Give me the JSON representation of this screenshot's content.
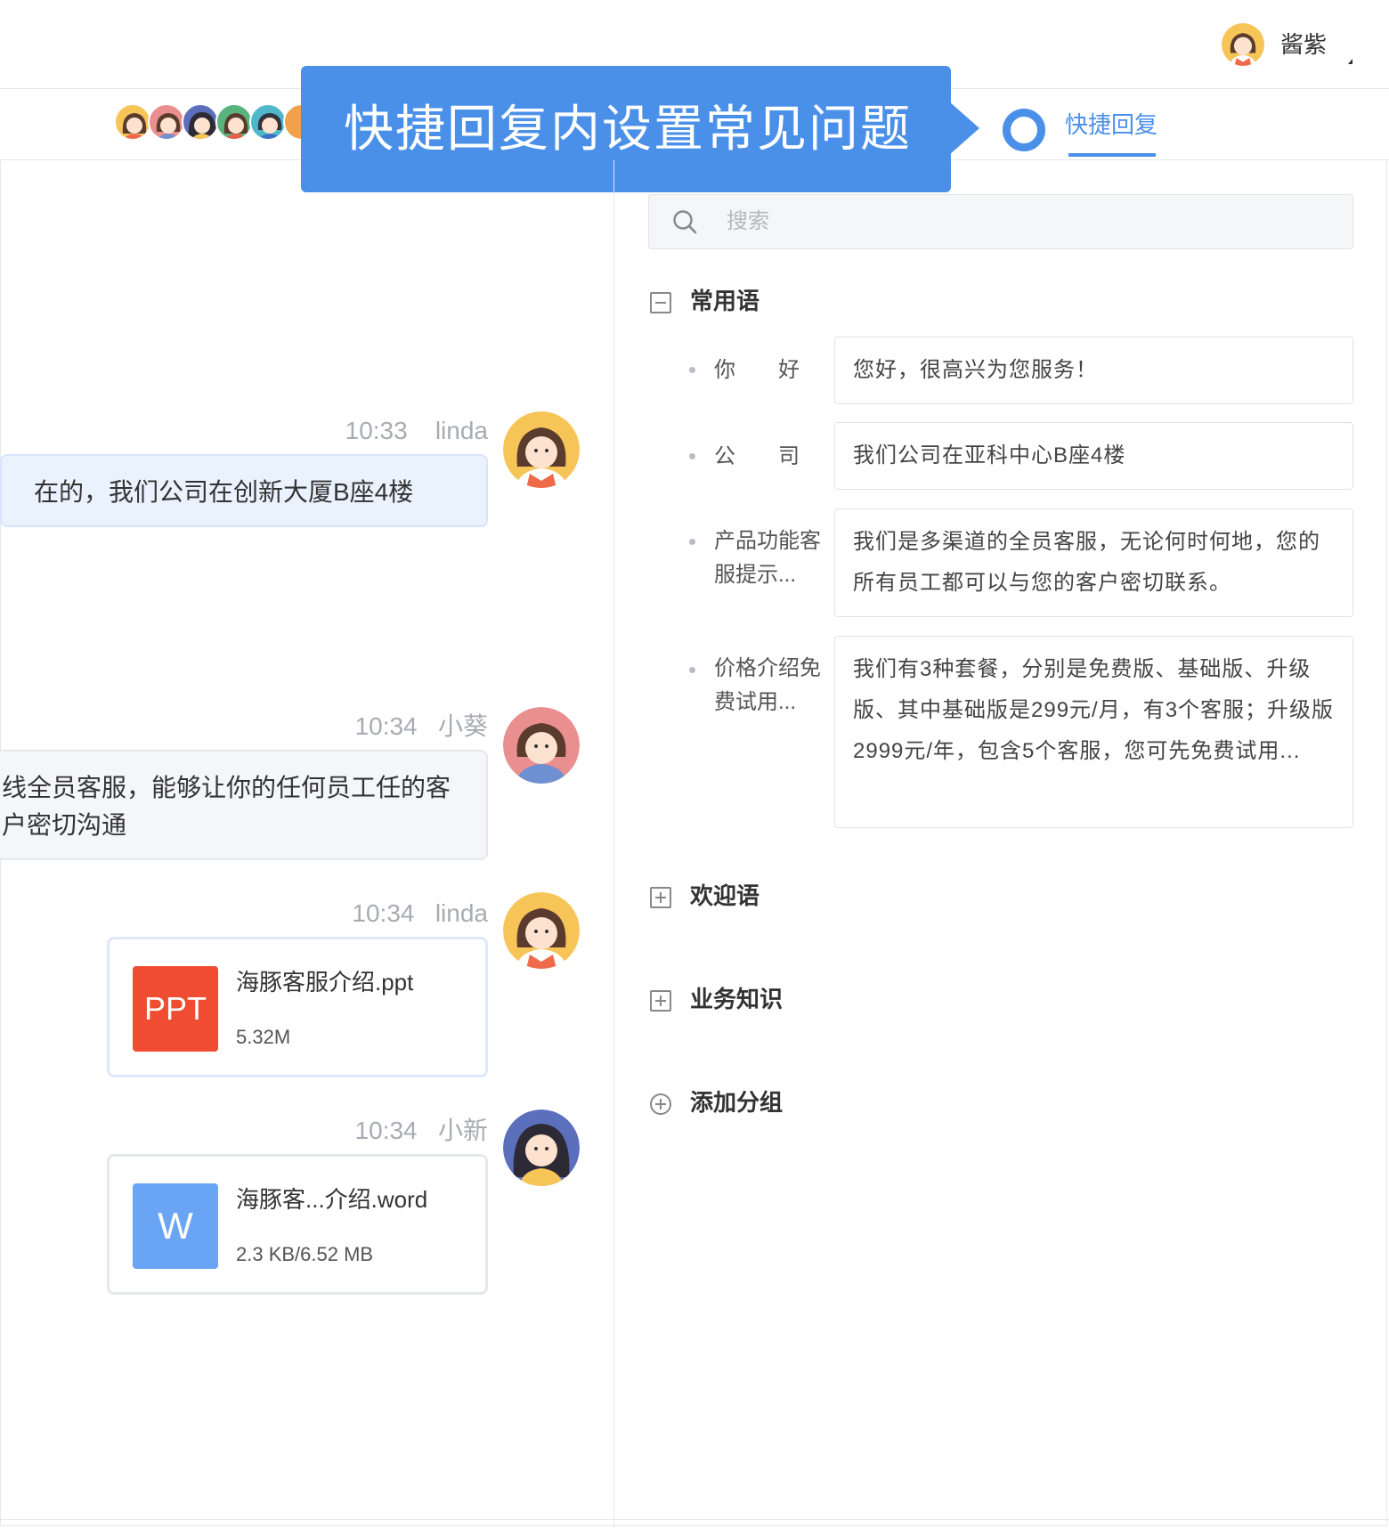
{
  "header": {
    "user_name": "酱紫"
  },
  "callout": {
    "text": "快捷回复内设置常见问题"
  },
  "tab": {
    "label": "快捷回复"
  },
  "search": {
    "placeholder": "搜索"
  },
  "groups": [
    {
      "label": "常用语",
      "state": "expanded"
    },
    {
      "label": "欢迎语",
      "state": "collapsed"
    },
    {
      "label": "业务知识",
      "state": "collapsed"
    },
    {
      "label": "添加分组",
      "state": "add"
    }
  ],
  "replies": [
    {
      "key": "你　　好",
      "text": "您好，很高兴为您服务！"
    },
    {
      "key": "公　　司",
      "text": "我们公司在亚科中心B座4楼"
    },
    {
      "key": "产品功能客服提示...",
      "text": "我们是多渠道的全员客服，无论何时何地，您的所有员工都可以与您的客户密切联系。"
    },
    {
      "key": "价格介绍免费试用...",
      "text": "我们有3种套餐，分别是免费版、基础版、升级版、其中基础版是299元/月，有3个客服；升级版2999元/年，包含5个客服，您可先免费试用..."
    }
  ],
  "messages": [
    {
      "time": "10:33",
      "sender": "linda",
      "text": "在的，我们公司在创新大厦B座4楼"
    },
    {
      "time": "10:34",
      "sender": "小葵",
      "text": "线全员客服，能够让你的任何员工任的客户密切沟通"
    },
    {
      "time": "10:34",
      "sender": "linda",
      "file_type": "PPT",
      "file_name": "海豚客服介绍.ppt",
      "file_size": "5.32M"
    },
    {
      "time": "10:34",
      "sender": "小新",
      "file_type": "W",
      "file_name": "海豚客...介绍.word",
      "file_size": "2.3 KB/6.52 MB"
    }
  ],
  "colors": {
    "accent": "#4a90e8",
    "ppt": "#f04c31",
    "word": "#6aa4f4",
    "bubble": "#eaf2fe"
  }
}
